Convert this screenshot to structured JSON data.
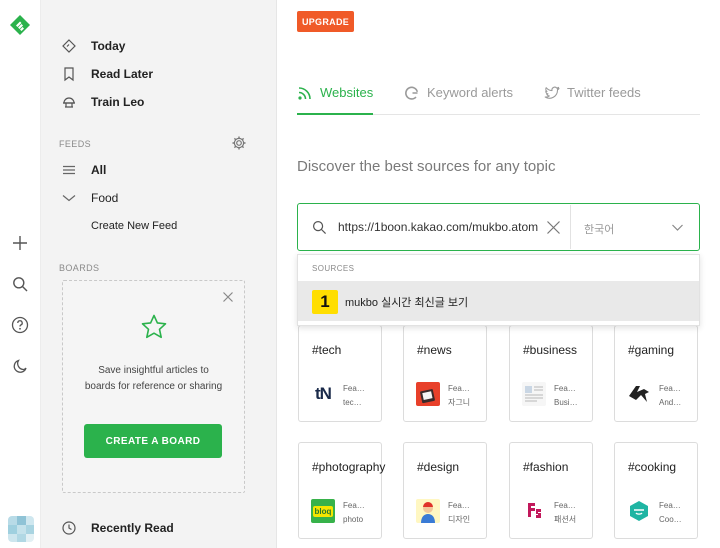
{
  "colors": {
    "brand": "#2bb24c",
    "upgrade": "#f05a28",
    "source_badge": "#ffde00"
  },
  "sidebar": {
    "nav": [
      {
        "label": "Today",
        "icon": "today-icon"
      },
      {
        "label": "Read Later",
        "icon": "bookmark-icon"
      },
      {
        "label": "Train Leo",
        "icon": "leo-icon"
      }
    ],
    "feeds_title": "FEEDS",
    "feeds": [
      {
        "label": "All",
        "icon": "list-icon"
      },
      {
        "label": "Food",
        "icon": "chevron-down-icon"
      },
      {
        "label": "Create New Feed"
      }
    ],
    "boards_title": "BOARDS",
    "board_card": {
      "text_line1": "Save insightful articles to",
      "text_line2": "boards for reference or sharing",
      "button": "CREATE A BOARD"
    },
    "recently_read": "Recently Read"
  },
  "main": {
    "upgrade": "UPGRADE",
    "tabs": [
      {
        "label": "Websites",
        "icon": "rss-icon",
        "active": true
      },
      {
        "label": "Keyword alerts",
        "icon": "google-icon",
        "active": false
      },
      {
        "label": "Twitter feeds",
        "icon": "twitter-icon",
        "active": false
      }
    ],
    "heading": "Discover the best sources for any topic",
    "search": {
      "value": "https://1boon.kakao.com/mukbo.atom",
      "language": "한국어"
    },
    "dropdown": {
      "title": "SOURCES",
      "item_badge": "1",
      "item_label": "mukbo 실시간 최신글 보기"
    },
    "topics": [
      {
        "name": "#tech",
        "feed_l1": "Fea…",
        "feed_l2": "tec…",
        "icon_text": "tN"
      },
      {
        "name": "#news",
        "feed_l1": "Fea…",
        "feed_l2": "자그니",
        "icon_text": ""
      },
      {
        "name": "#business",
        "feed_l1": "Fea…",
        "feed_l2": "Busi…",
        "icon_text": ""
      },
      {
        "name": "#gaming",
        "feed_l1": "Fea…",
        "feed_l2": "And…",
        "icon_text": ""
      },
      {
        "name": "#photography",
        "feed_l1": "Fea…",
        "feed_l2": "photo",
        "icon_text": "bloq"
      },
      {
        "name": "#design",
        "feed_l1": "Fea…",
        "feed_l2": "디자인",
        "icon_text": ""
      },
      {
        "name": "#fashion",
        "feed_l1": "Fea…",
        "feed_l2": "패션서",
        "icon_text": ""
      },
      {
        "name": "#cooking",
        "feed_l1": "Fea…",
        "feed_l2": "Coo…",
        "icon_text": ""
      }
    ]
  }
}
